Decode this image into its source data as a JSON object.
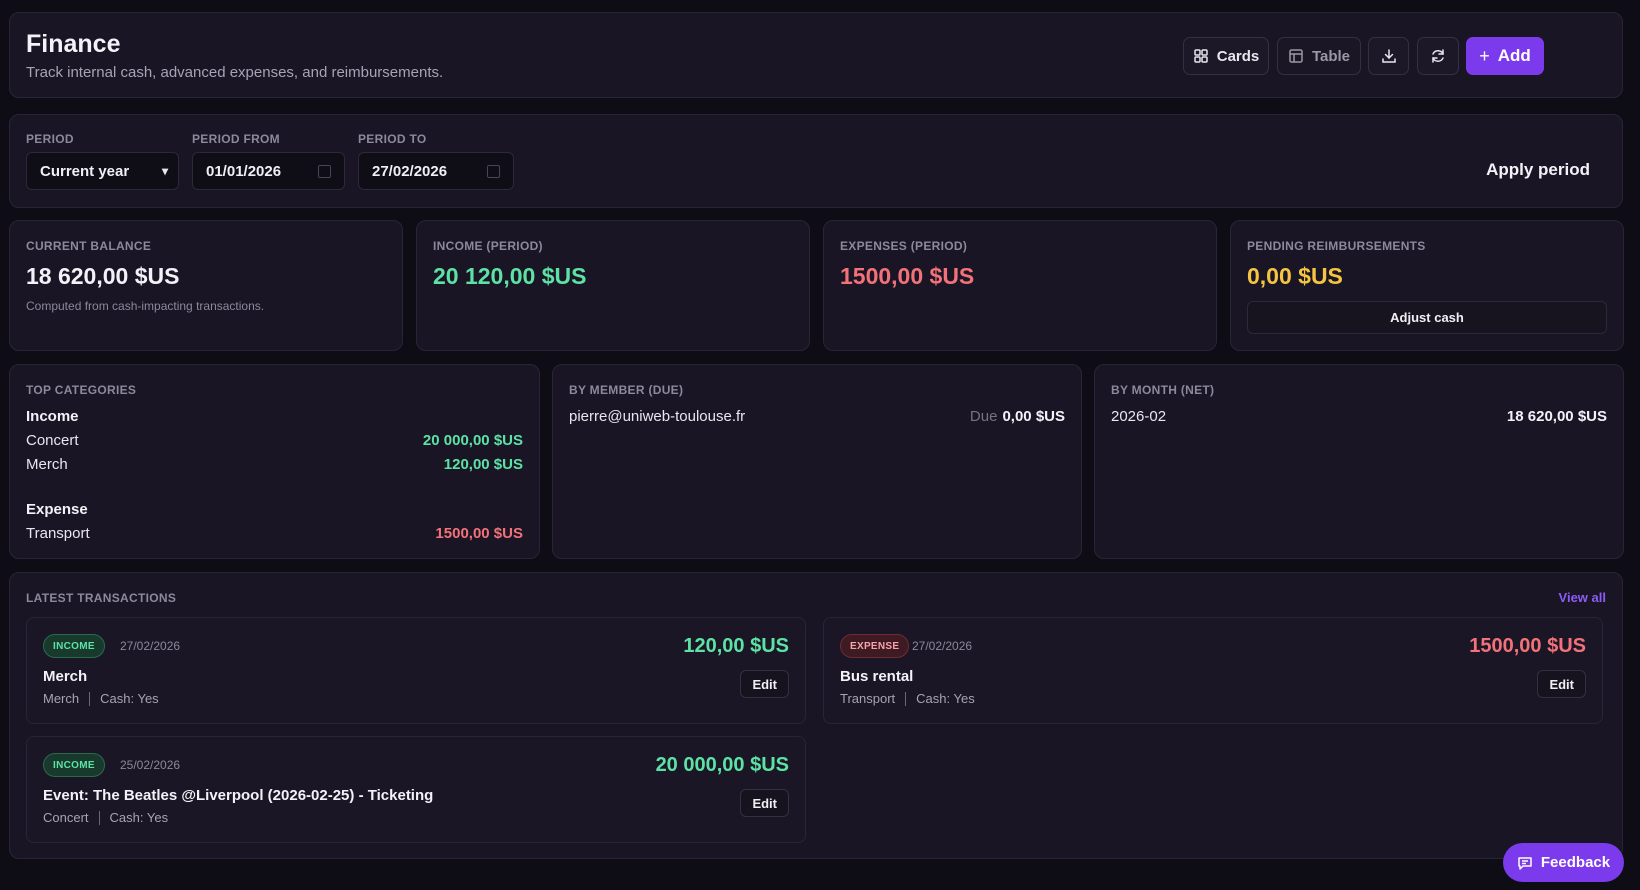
{
  "header": {
    "title": "Finance",
    "subtitle": "Track internal cash, advanced expenses, and reimbursements.",
    "cards_label": "Cards",
    "table_label": "Table",
    "add_label": "Add"
  },
  "period": {
    "period_label": "PERIOD",
    "period_value": "Current year",
    "from_label": "PERIOD FROM",
    "from_value": "01/01/2026",
    "to_label": "PERIOD TO",
    "to_value": "27/02/2026",
    "apply_label": "Apply period"
  },
  "stats": {
    "balance": {
      "label": "CURRENT BALANCE",
      "value": "18 620,00 $US",
      "note": "Computed from cash-impacting transactions."
    },
    "income": {
      "label": "INCOME (PERIOD)",
      "value": "20 120,00 $US"
    },
    "expenses": {
      "label": "EXPENSES (PERIOD)",
      "value": "1500,00 $US"
    },
    "pending": {
      "label": "PENDING REIMBURSEMENTS",
      "value": "0,00 $US",
      "adjust_label": "Adjust cash"
    }
  },
  "top_categories": {
    "label": "TOP CATEGORIES",
    "income_heading": "Income",
    "income_items": [
      {
        "name": "Concert",
        "value": "20 000,00 $US"
      },
      {
        "name": "Merch",
        "value": "120,00 $US"
      }
    ],
    "expense_heading": "Expense",
    "expense_items": [
      {
        "name": "Transport",
        "value": "1500,00 $US"
      }
    ]
  },
  "by_member": {
    "label": "BY MEMBER (DUE)",
    "items": [
      {
        "email": "pierre@uniweb-toulouse.fr",
        "due_label": "Due",
        "value": "0,00 $US"
      }
    ]
  },
  "by_month": {
    "label": "BY MONTH (NET)",
    "items": [
      {
        "month": "2026-02",
        "value": "18 620,00 $US"
      }
    ]
  },
  "latest": {
    "label": "LATEST TRANSACTIONS",
    "view_all": "View all",
    "edit_label": "Edit",
    "transactions": [
      {
        "type": "INCOME",
        "date": "27/02/2026",
        "amount": "120,00 $US",
        "title": "Merch",
        "category": "Merch",
        "cash": "Cash: Yes"
      },
      {
        "type": "EXPENSE",
        "date": "27/02/2026",
        "amount": "1500,00 $US",
        "title": "Bus rental",
        "category": "Transport",
        "cash": "Cash: Yes"
      },
      {
        "type": "INCOME",
        "date": "25/02/2026",
        "amount": "20 000,00 $US",
        "title": "Event: The Beatles @Liverpool (2026-02-25) - Ticketing",
        "category": "Concert",
        "cash": "Cash: Yes"
      }
    ]
  },
  "feedback_label": "Feedback",
  "colors": {
    "accent": "#7c3aed",
    "income": "#5de2a5",
    "expense": "#f3727a",
    "pending": "#f5c542"
  }
}
